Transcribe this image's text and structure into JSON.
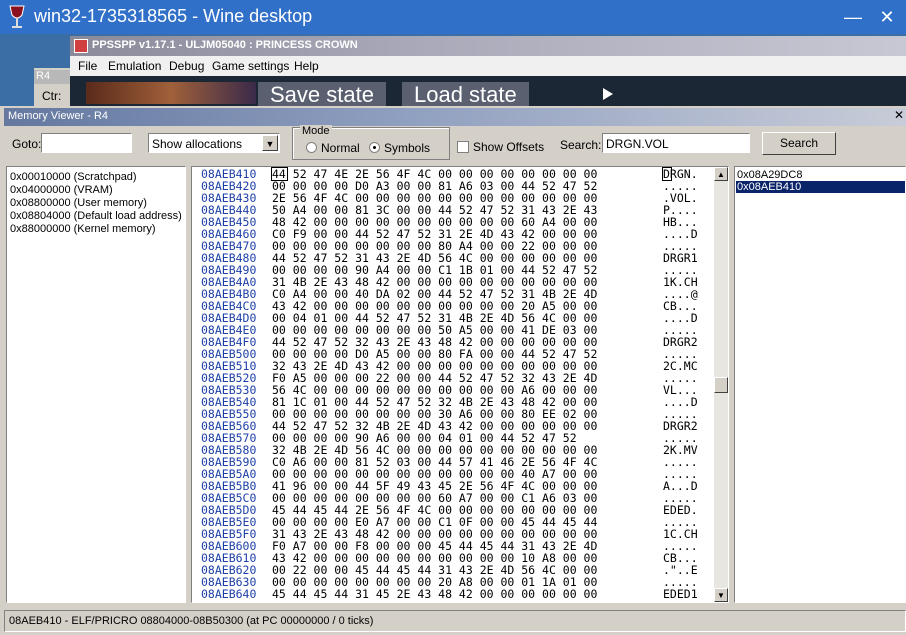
{
  "wine": {
    "title": "win32-1735318565 - Wine desktop",
    "minimize_glyph": "—",
    "close_glyph": "✕"
  },
  "ppsspp": {
    "title": "PPSSPP v1.17.1 - ULJM05040 : PRINCESS CROWN",
    "menu": [
      "File",
      "Emulation",
      "Debug",
      "Game settings",
      "Help"
    ],
    "overlay_buttons": [
      "Save state",
      "Load state"
    ]
  },
  "disasm": {
    "tab": "R4",
    "ctr_label": "Ctr:"
  },
  "memview": {
    "title": "Memory Viewer - R4",
    "goto_label": "Goto:",
    "goto_value": "",
    "alloc_select": "Show allocations",
    "mode_label": "Mode",
    "mode_normal": "Normal",
    "mode_symbols": "Symbols",
    "mode_selected": "Symbols",
    "show_offsets_label": "Show Offsets",
    "show_offsets_checked": false,
    "search_label": "Search:",
    "search_value": "DRGN.VOL",
    "search_button": "Search",
    "regions": [
      "0x00010000 (Scratchpad)",
      "0x04000000 (VRAM)",
      "0x08800000 (User memory)",
      "0x08804000 (Default load address)",
      "0x88000000 (Kernel memory)"
    ],
    "results": [
      "0x08A29DC8",
      "0x08AEB410"
    ],
    "selected_result": "0x08AEB410",
    "status": "08AEB410 - ELF/PRICRO 08804000-08B50300 (at PC 00000000 / 0 ticks)",
    "rows": [
      {
        "addr": "08AEB410",
        "bytes": "44 52 47 4E 2E 56 4F 4C 00 00 00 00 00 00 00 00",
        "ascii": "DRGN."
      },
      {
        "addr": "08AEB420",
        "bytes": "00 00 00 00 D0 A3 00 00 81 A6 03 00 44 52 47 52",
        "ascii": "....."
      },
      {
        "addr": "08AEB430",
        "bytes": "2E 56 4F 4C 00 00 00 00 00 00 00 00 00 00 00 00",
        "ascii": ".VOL."
      },
      {
        "addr": "08AEB440",
        "bytes": "50 A4 00 00 81 3C 00 00 44 52 47 52 31 43 2E 43",
        "ascii": "P...."
      },
      {
        "addr": "08AEB450",
        "bytes": "48 42 00 00 00 00 00 00 00 00 00 00 60 A4 00 00",
        "ascii": "HB..."
      },
      {
        "addr": "08AEB460",
        "bytes": "C0 F9 00 00 44 52 47 52 31 2E 4D 43 42 00 00 00",
        "ascii": "....D"
      },
      {
        "addr": "08AEB470",
        "bytes": "00 00 00 00 00 00 00 00 80 A4 00 00 22 00 00 00",
        "ascii": "....."
      },
      {
        "addr": "08AEB480",
        "bytes": "44 52 47 52 31 43 2E 4D 56 4C 00 00 00 00 00 00",
        "ascii": "DRGR1"
      },
      {
        "addr": "08AEB490",
        "bytes": "00 00 00 00 90 A4 00 00 C1 1B 01 00 44 52 47 52",
        "ascii": "....."
      },
      {
        "addr": "08AEB4A0",
        "bytes": "31 4B 2E 43 48 42 00 00 00 00 00 00 00 00 00 00",
        "ascii": "1K.CH"
      },
      {
        "addr": "08AEB4B0",
        "bytes": "C0 A4 00 00 40 DA 02 00 44 52 47 52 31 4B 2E 4D",
        "ascii": "....@"
      },
      {
        "addr": "08AEB4C0",
        "bytes": "43 42 00 00 00 00 00 00 00 00 00 00 20 A5 00 00",
        "ascii": "CB..."
      },
      {
        "addr": "08AEB4D0",
        "bytes": "00 04 01 00 44 52 47 52 31 4B 2E 4D 56 4C 00 00",
        "ascii": "....D"
      },
      {
        "addr": "08AEB4E0",
        "bytes": "00 00 00 00 00 00 00 00 50 A5 00 00 41 DE 03 00",
        "ascii": "....."
      },
      {
        "addr": "08AEB4F0",
        "bytes": "44 52 47 52 32 43 2E 43 48 42 00 00 00 00 00 00",
        "ascii": "DRGR2"
      },
      {
        "addr": "08AEB500",
        "bytes": "00 00 00 00 D0 A5 00 00 80 FA 00 00 44 52 47 52",
        "ascii": "....."
      },
      {
        "addr": "08AEB510",
        "bytes": "32 43 2E 4D 43 42 00 00 00 00 00 00 00 00 00 00",
        "ascii": "2C.MC"
      },
      {
        "addr": "08AEB520",
        "bytes": "F0 A5 00 00 00 22 00 00 44 52 47 52 32 43 2E 4D",
        "ascii": "....."
      },
      {
        "addr": "08AEB530",
        "bytes": "56 4C 00 00 00 00 00 00 00 00 00 00 A6 00 00 00",
        "ascii": "VL..."
      },
      {
        "addr": "08AEB540",
        "bytes": "81 1C 01 00 44 52 47 52 32 4B 2E 43 48 42 00 00",
        "ascii": "....D"
      },
      {
        "addr": "08AEB550",
        "bytes": "00 00 00 00 00 00 00 00 30 A6 00 00 80 EE 02 00",
        "ascii": "....."
      },
      {
        "addr": "08AEB560",
        "bytes": "44 52 47 52 32 4B 2E 4D 43 42 00 00 00 00 00 00",
        "ascii": "DRGR2"
      },
      {
        "addr": "08AEB570",
        "bytes": "00 00 00 00 90 A6 00 00 04 01 00 44 52 47 52",
        "ascii": "....."
      },
      {
        "addr": "08AEB580",
        "bytes": "32 4B 2E 4D 56 4C 00 00 00 00 00 00 00 00 00 00",
        "ascii": "2K.MV"
      },
      {
        "addr": "08AEB590",
        "bytes": "C0 A6 00 00 81 52 03 00 44 57 41 46 2E 56 4F 4C",
        "ascii": "....."
      },
      {
        "addr": "08AEB5A0",
        "bytes": "00 00 00 00 00 00 00 00 00 00 00 00 40 A7 00 00",
        "ascii": "....."
      },
      {
        "addr": "08AEB5B0",
        "bytes": "41 96 00 00 44 5F 49 43 45 2E 56 4F 4C 00 00 00",
        "ascii": "A...D"
      },
      {
        "addr": "08AEB5C0",
        "bytes": "00 00 00 00 00 00 00 00 60 A7 00 00 C1 A6 03 00",
        "ascii": "....."
      },
      {
        "addr": "08AEB5D0",
        "bytes": "45 44 45 44 2E 56 4F 4C 00 00 00 00 00 00 00 00",
        "ascii": "EDED."
      },
      {
        "addr": "08AEB5E0",
        "bytes": "00 00 00 00 E0 A7 00 00 C1 0F 00 00 45 44 45 44",
        "ascii": "....."
      },
      {
        "addr": "08AEB5F0",
        "bytes": "31 43 2E 43 48 42 00 00 00 00 00 00 00 00 00 00",
        "ascii": "1C.CH"
      },
      {
        "addr": "08AEB600",
        "bytes": "F0 A7 00 00 F8 00 00 00 45 44 45 44 31 43 2E 4D",
        "ascii": "....."
      },
      {
        "addr": "08AEB610",
        "bytes": "43 42 00 00 00 00 00 00 00 00 00 00 10 A8 00 00",
        "ascii": "CB..."
      },
      {
        "addr": "08AEB620",
        "bytes": "00 22 00 00 45 44 45 44 31 43 2E 4D 56 4C 00 00",
        "ascii": ".\"..E"
      },
      {
        "addr": "08AEB630",
        "bytes": "00 00 00 00 00 00 00 00 20 A8 00 00 01 1A 01 00",
        "ascii": "....."
      },
      {
        "addr": "08AEB640",
        "bytes": "45 44 45 44 31 45 2E 43 48 42 00 00 00 00 00 00",
        "ascii": "EDED1"
      }
    ]
  },
  "colors": {
    "wine_titlebar": "#3170c8",
    "address_text": "#1c3fa8",
    "selection": "#0a246a"
  }
}
